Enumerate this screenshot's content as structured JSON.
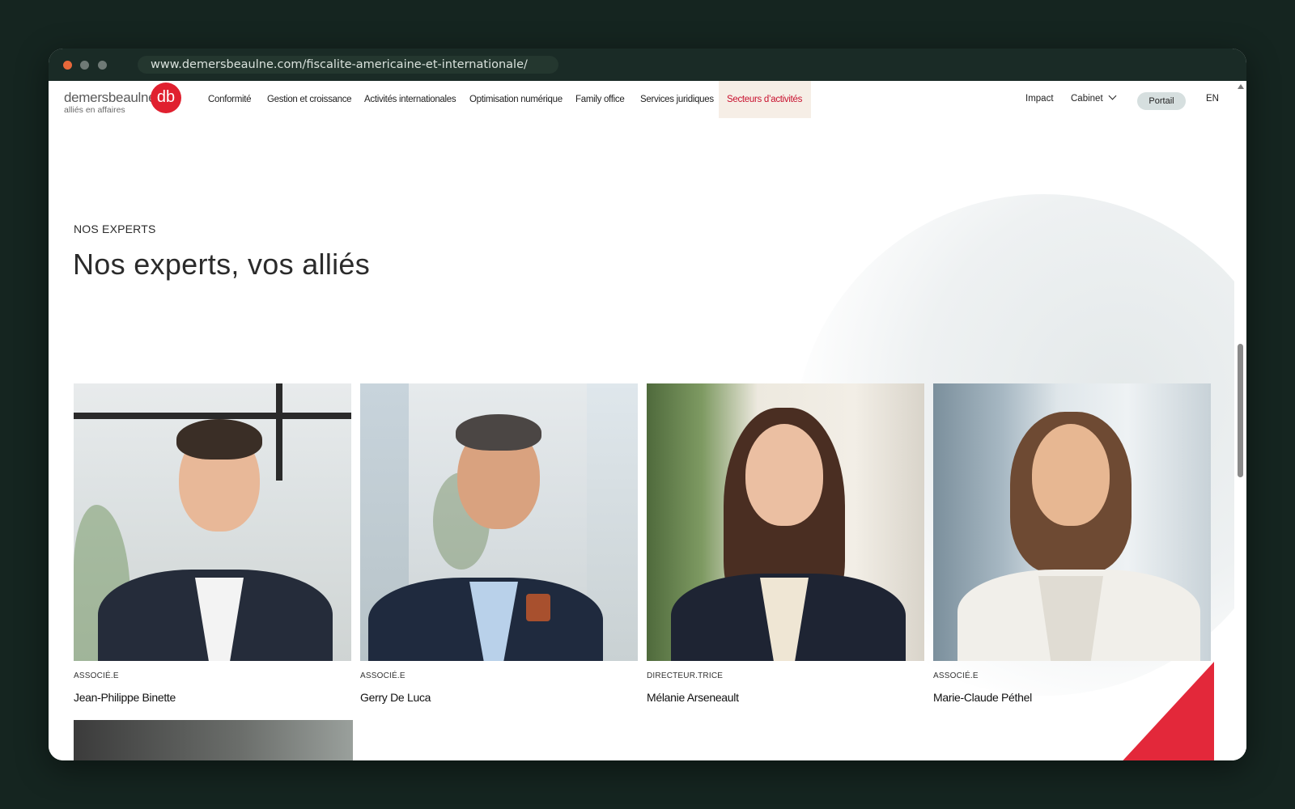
{
  "browser": {
    "url": "www.demersbeaulne.com/fiscalite-americaine-et-internationale/"
  },
  "nav": {
    "logo_name": "demersbeaulne",
    "logo_tagline": "alliés en affaires",
    "logo_mark": "db",
    "items": [
      {
        "label": "Conformité"
      },
      {
        "label": "Gestion et croissance"
      },
      {
        "label": "Activités internationales"
      },
      {
        "label": "Optimisation numérique"
      },
      {
        "label": "Family office"
      },
      {
        "label": "Services juridiques"
      },
      {
        "label": "Secteurs d’activités",
        "active": true
      }
    ],
    "right": {
      "impact": "Impact",
      "cabinet": "Cabinet",
      "portail": "Portail",
      "language": "EN"
    }
  },
  "section": {
    "eyebrow": "NOS EXPERTS",
    "title": "Nos experts, vos alliés"
  },
  "experts": [
    {
      "role": "ASSOCIÉ.E",
      "name": "Jean-Philippe Binette"
    },
    {
      "role": "ASSOCIÉ.E",
      "name": "Gerry De Luca"
    },
    {
      "role": "DIRECTEUR.TRICE",
      "name": "Mélanie Arseneault"
    },
    {
      "role": "ASSOCIÉ.E",
      "name": "Marie-Claude Péthel"
    }
  ],
  "colors": {
    "brand_red": "#e0202f",
    "active_nav_text": "#c8102e",
    "active_nav_bg": "#f6eee6",
    "portail_bg": "#d6dfdf"
  }
}
